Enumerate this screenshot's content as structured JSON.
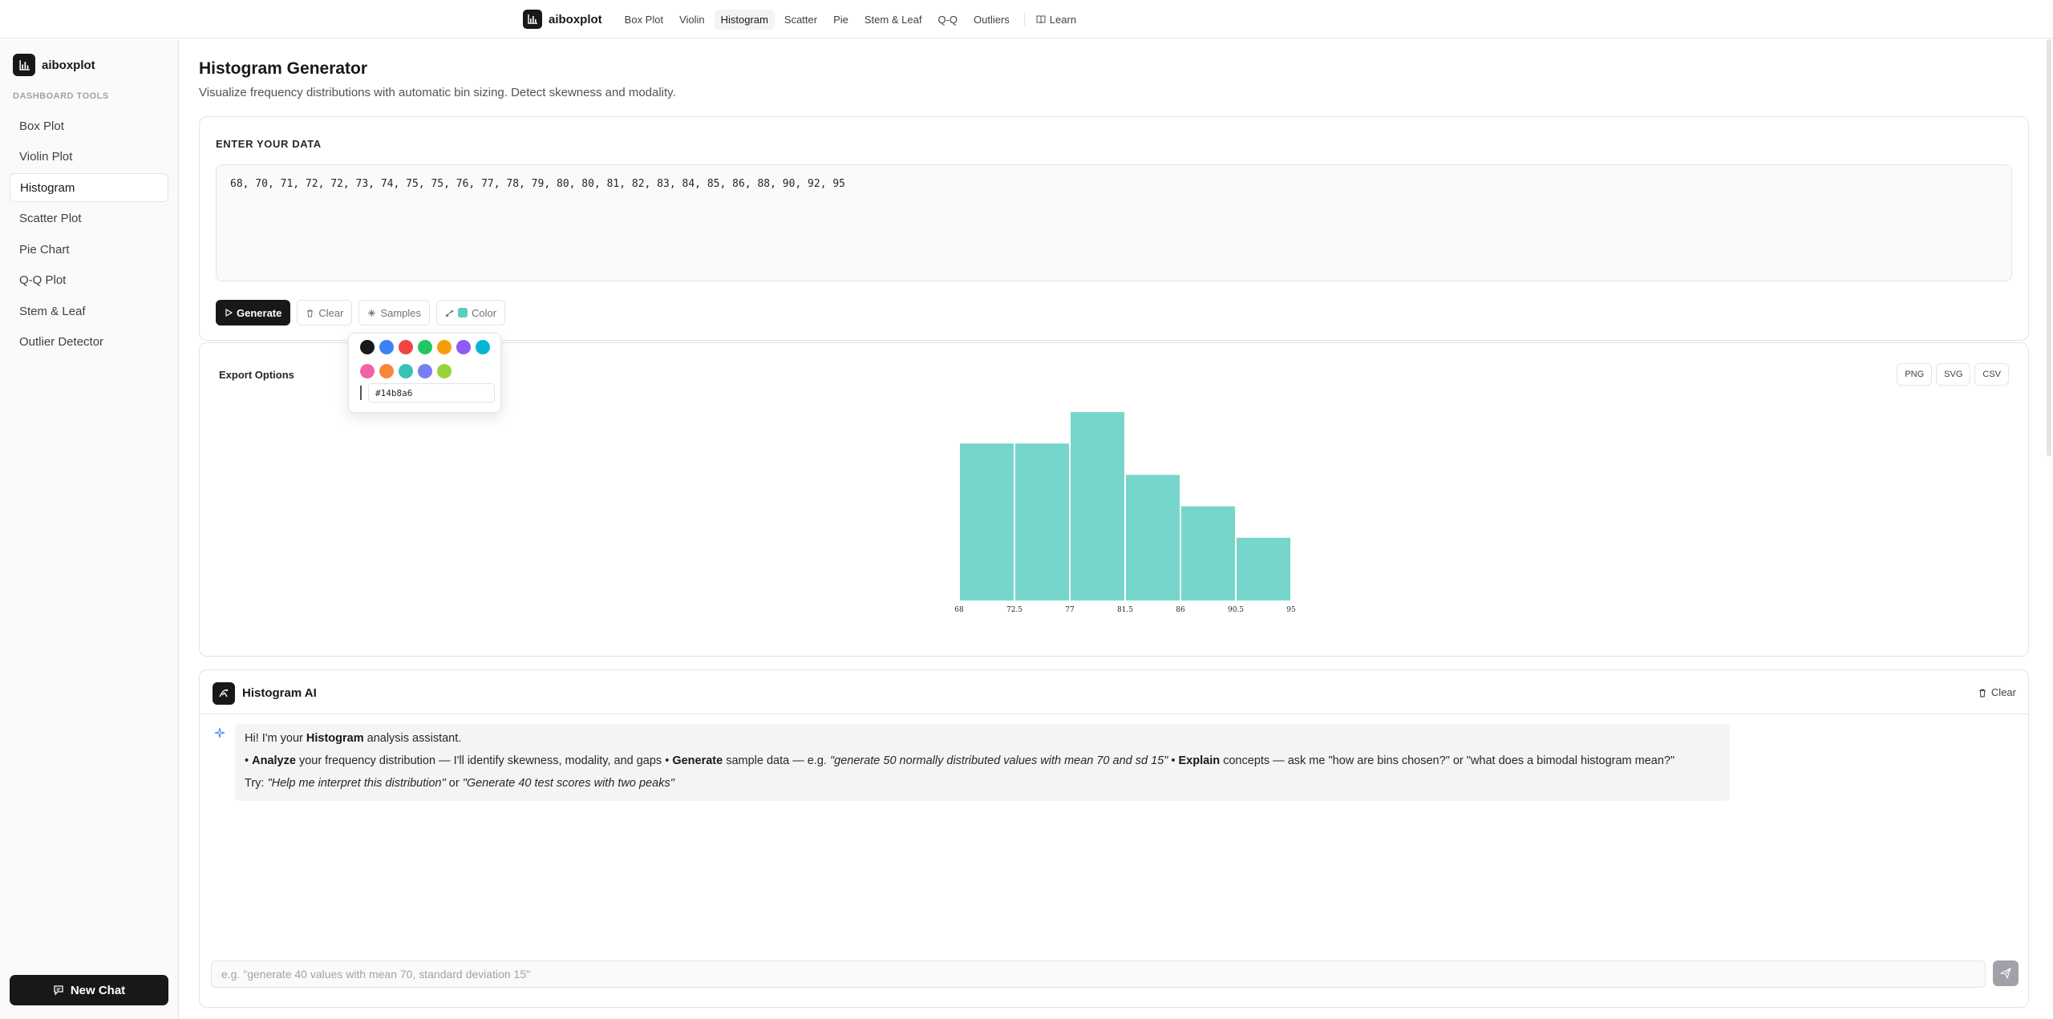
{
  "topnav": {
    "brand": "aiboxplot",
    "links": [
      "Box Plot",
      "Violin",
      "Histogram",
      "Scatter",
      "Pie",
      "Stem & Leaf",
      "Q-Q",
      "Outliers"
    ],
    "active": "Histogram",
    "learn": "Learn"
  },
  "sidebar": {
    "brand": "aiboxplot",
    "section": "DASHBOARD TOOLS",
    "items": [
      "Box Plot",
      "Violin Plot",
      "Histogram",
      "Scatter Plot",
      "Pie Chart",
      "Q-Q Plot",
      "Stem & Leaf",
      "Outlier Detector"
    ],
    "active": "Histogram",
    "new_chat": "New Chat"
  },
  "main": {
    "title": "Histogram Generator",
    "subtitle": "Visualize frequency distributions with automatic bin sizing. Detect skewness and modality."
  },
  "data_card": {
    "label": "ENTER YOUR DATA",
    "value": "68, 70, 71, 72, 72, 73, 74, 75, 75, 76, 77, 78, 79, 80, 80, 81, 82, 83, 84, 85, 86, 88, 90, 92, 95",
    "buttons": {
      "generate": "Generate",
      "clear": "Clear",
      "samples": "Samples",
      "color": "Color"
    }
  },
  "color_popover": {
    "swatches": [
      "#18181b",
      "#3b82f6",
      "#ef4444",
      "#22c55e",
      "#f59e0b",
      "#8b5cf6",
      "#06b6d4",
      "#ec4899",
      "#f97316",
      "#14b8a6",
      "#6366f1",
      "#84cc16"
    ],
    "hex_value": "#14b8a6"
  },
  "chart_card": {
    "export_label": "Export Options",
    "export_buttons": [
      "PNG",
      "SVG",
      "CSV"
    ]
  },
  "chart_data": {
    "type": "bar",
    "bin_edges": [
      68,
      72.5,
      77,
      81.5,
      86,
      90.5,
      95
    ],
    "tick_labels": [
      "68",
      "72.5",
      "77",
      "81.5",
      "86",
      "90.5",
      "95"
    ],
    "counts": [
      5,
      5,
      6,
      4,
      3,
      2
    ],
    "color": "#14b8a6",
    "ylim": [
      0,
      6
    ],
    "grid": false,
    "title": "",
    "xlabel": "",
    "ylabel": ""
  },
  "ai_panel": {
    "title": "Histogram AI",
    "clear": "Clear",
    "message": {
      "l1_a": "Hi! I'm your ",
      "l1_b": "Histogram",
      "l1_c": " analysis assistant.",
      "l2_b1": "• ",
      "l2_k1": "Analyze",
      "l2_t1": " your frequency distribution — I'll identify skewness, modality, and gaps ",
      "l2_b2": "• ",
      "l2_k2": "Generate",
      "l2_t2": " sample data — e.g. ",
      "l2_q2": "\"generate 50 normally distributed values with mean 70 and sd 15\"",
      "l2_b3": " • ",
      "l2_k3": "Explain",
      "l2_t3": " concepts — ask me \"how are bins chosen?\" or \"what does a bimodal histogram mean?\"",
      "l3_a": "Try: ",
      "l3_q1": "\"Help me interpret this distribution\"",
      "l3_or": " or ",
      "l3_q2": "\"Generate 40 test scores with two peaks\""
    },
    "input_placeholder": "e.g. \"generate 40 values with mean 70, standard deviation 15\""
  }
}
